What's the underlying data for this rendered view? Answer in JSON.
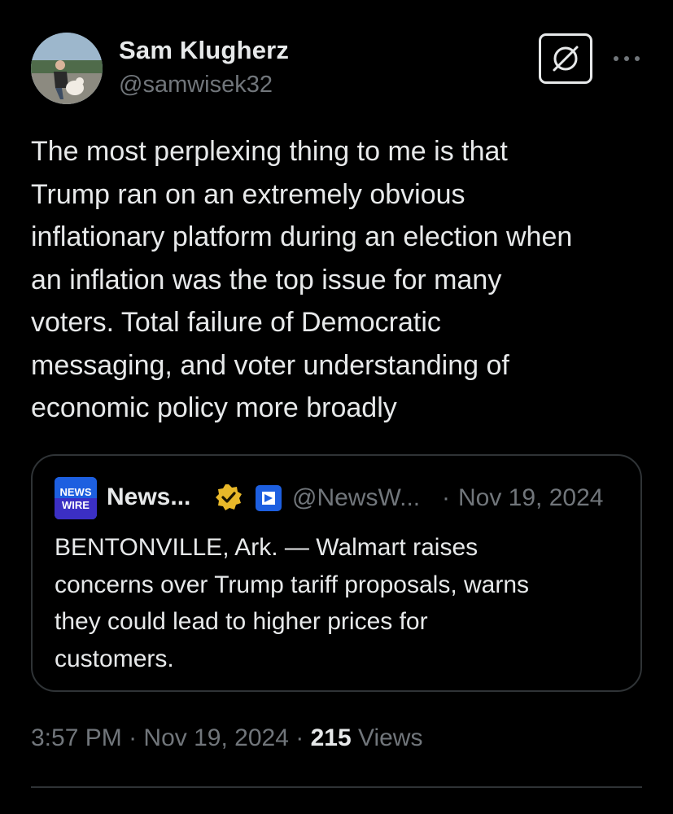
{
  "author": {
    "name": "Sam Klugherz",
    "handle": "@samwisek32"
  },
  "post": {
    "text": "The most perplexing thing to me is that\nTrump ran on an extremely obvious\ninflationary platform during an election when\nan inflation was the top issue for many\nvoters. Total failure of Democratic\nmessaging, and voter understanding of\neconomic policy more broadly"
  },
  "quoted_post": {
    "logo_text_line1": "NEWS",
    "logo_text_line2": "WIRE",
    "name": "News...",
    "handle": "@NewsW...",
    "separator": "·",
    "date": "Nov 19, 2024",
    "text": "BENTONVILLE, Ark. — Walmart raises\nconcerns over Trump tariff proposals, warns\nthey could lead to higher prices for\ncustomers."
  },
  "meta": {
    "time": "3:57 PM",
    "separator": "·",
    "date": "Nov 19, 2024",
    "views_count": "215",
    "views_label": "Views"
  },
  "icons": {
    "grok": "grok-icon",
    "more": "more-dots-icon",
    "verified": "verified-badge-icon",
    "affiliate": "affiliate-badge-icon"
  },
  "colors": {
    "background": "#000000",
    "text_primary": "#e7e9ea",
    "text_secondary": "#71767b",
    "border": "#2f3336",
    "verified_gold": "#e8b829",
    "affiliate_blue": "#1d5fe0"
  }
}
